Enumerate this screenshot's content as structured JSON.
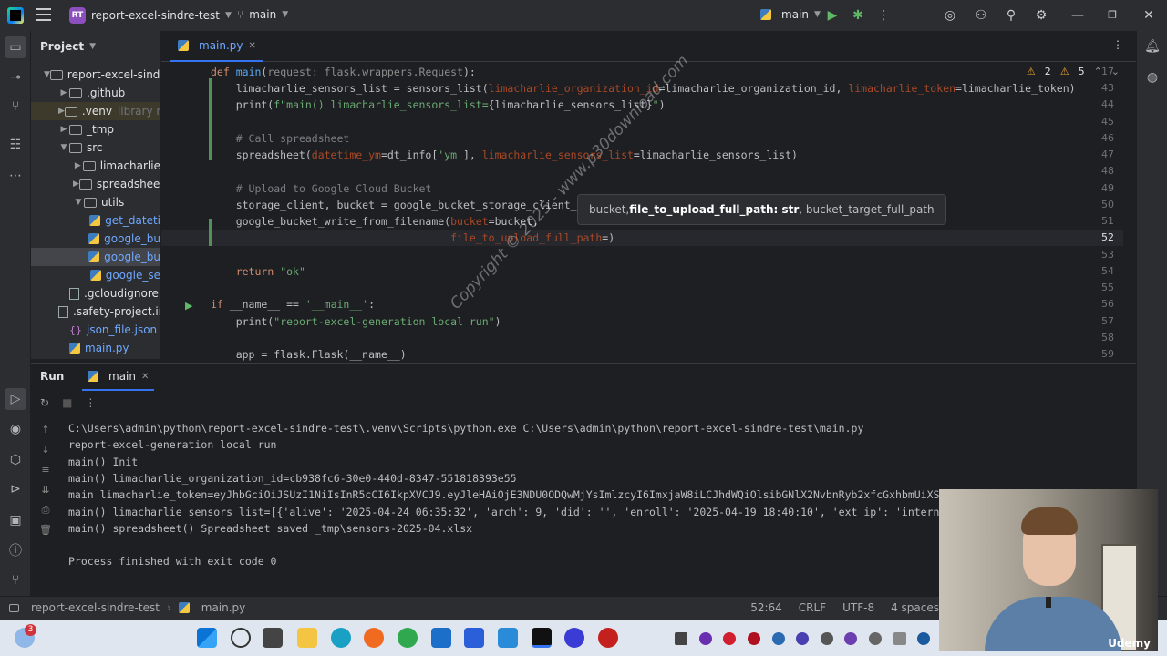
{
  "titlebar": {
    "project_badge": "RT",
    "project_name": "report-excel-sindre-test",
    "branch": "main",
    "run_config": "main"
  },
  "project_pane": {
    "title": "Project",
    "tree": [
      {
        "label": "report-excel-sindre",
        "kind": "folder",
        "depth": 0,
        "expanded": true
      },
      {
        "label": ".github",
        "kind": "folder",
        "depth": 1
      },
      {
        "label": ".venv",
        "kind": "folder",
        "depth": 1,
        "note": "library roo"
      },
      {
        "label": "_tmp",
        "kind": "folder",
        "depth": 1
      },
      {
        "label": "src",
        "kind": "folder",
        "depth": 1,
        "expanded": true
      },
      {
        "label": "limacharlie",
        "kind": "folder",
        "depth": 2
      },
      {
        "label": "spreadsheet",
        "kind": "folder",
        "depth": 2
      },
      {
        "label": "utils",
        "kind": "folder",
        "depth": 2,
        "expanded": true
      },
      {
        "label": "get_dateti",
        "kind": "py",
        "depth": 3
      },
      {
        "label": "google_bu",
        "kind": "py",
        "depth": 3
      },
      {
        "label": "google_bu",
        "kind": "py",
        "depth": 3,
        "selected": true
      },
      {
        "label": "google_se",
        "kind": "py",
        "depth": 3
      },
      {
        "label": ".gcloudignore",
        "kind": "txt",
        "depth": 1
      },
      {
        "label": ".safety-project.ir",
        "kind": "txt",
        "depth": 1
      },
      {
        "label": "json_file.json",
        "kind": "json",
        "depth": 1
      },
      {
        "label": "main.py",
        "kind": "py",
        "depth": 1
      }
    ]
  },
  "editor": {
    "tab_label": "main.py",
    "inspections": {
      "warnings": "2",
      "weak_warnings": "5"
    },
    "sticky_line": {
      "num": "17",
      "text": "def main(request: flask.wrappers.Request):"
    },
    "lines": [
      {
        "num": "43",
        "html": "    limacharlie_sensors_list = sensors_list(<span class=\"prm\">limacharlie_organization_id</span>=limacharlie_organization_id, <span class=\"prm\">limacharlie_token</span>=limacharlie_token)"
      },
      {
        "num": "44",
        "html": "    print(<span class=\"str\">f\"main() limacharlie_sensors_list=</span>{limacharlie_sensors_list}<span class=\"str\">\"</span>)"
      },
      {
        "num": "45",
        "html": ""
      },
      {
        "num": "46",
        "html": "    <span class=\"cmt\"># Call spreadsheet</span>"
      },
      {
        "num": "47",
        "html": "    spreadsheet(<span class=\"prm\">datetime_ym</span>=dt_info[<span class=\"str\">'ym'</span>], <span class=\"prm\">limacharlie_sensors_list</span>=limacharlie_sensors_list)"
      },
      {
        "num": "48",
        "html": ""
      },
      {
        "num": "49",
        "html": "    <span class=\"cmt\"># Upload to Google Cloud Bucket</span>"
      },
      {
        "num": "50",
        "html": "    storage_client, bucket = google_bucket_storage_client_and"
      },
      {
        "num": "51",
        "html": "    google_bucket_write_from_filename(<span class=\"prm\">bucket</span>=bucket,"
      },
      {
        "num": "52",
        "html": "                                      <span class=\"prm\">file_to_upload_full_path</span>=)"
      },
      {
        "num": "53",
        "html": ""
      },
      {
        "num": "54",
        "html": "    <span class=\"kw\">return</span> <span class=\"str\">\"ok\"</span>"
      },
      {
        "num": "55",
        "html": ""
      },
      {
        "num": "56",
        "html": "<span class=\"kw\">if</span> __name__ == <span class=\"str\">'__main__'</span>:"
      },
      {
        "num": "57",
        "html": "    print(<span class=\"str\">\"report-excel-generation local run\"</span>)"
      },
      {
        "num": "58",
        "html": ""
      },
      {
        "num": "59",
        "html": "    app = flask.Flask(__name__)"
      }
    ],
    "hint": {
      "pre": "bucket, ",
      "bold": "file_to_upload_full_path: str",
      "post": ", bucket_target_full_path"
    }
  },
  "run_panel": {
    "title": "Run",
    "tab_label": "main",
    "output": [
      "C:\\Users\\admin\\python\\report-excel-sindre-test\\.venv\\Scripts\\python.exe C:\\Users\\admin\\python\\report-excel-sindre-test\\main.py",
      "report-excel-generation local run",
      "main() Init",
      "main() limacharlie_organization_id=cb938fc6-30e0-440d-8347-551818393e55",
      "main limacharlie_token=eyJhbGciOiJSUzI1NiIsInR5cCI6IkpXVCJ9.eyJleHAiOjE3NDU0ODQwMjYsImlzcyI6ImxjaW8iLCJhdWQiOlsibGNlX2NvbnRyb2xfcGxhbmUiXSwiaWF",
      "main() limacharlie_sensors_list=[{'alive': '2025-04-24 06:35:32', 'arch': 9, 'did': '', 'enroll': '2025-04-19 18:40:10', 'ext_ip': 'internal',",
      "main() spreadsheet() Spreadsheet saved _tmp\\sensors-2025-04.xlsx",
      "",
      "Process finished with exit code 0"
    ]
  },
  "statusbar": {
    "project": "report-excel-sindre-test",
    "file": "main.py",
    "position": "52:64",
    "line_sep": "CRLF",
    "encoding": "UTF-8",
    "indent": "4 spaces"
  },
  "taskbar": {
    "notification_count": "3"
  },
  "webcam": {
    "brand": "Udemy"
  },
  "watermark": "Copyright © 2025 - www.p30download.com",
  "colors": {
    "accent": "#3574f0",
    "bg": "#1e1f22",
    "panel": "#2b2d30"
  }
}
